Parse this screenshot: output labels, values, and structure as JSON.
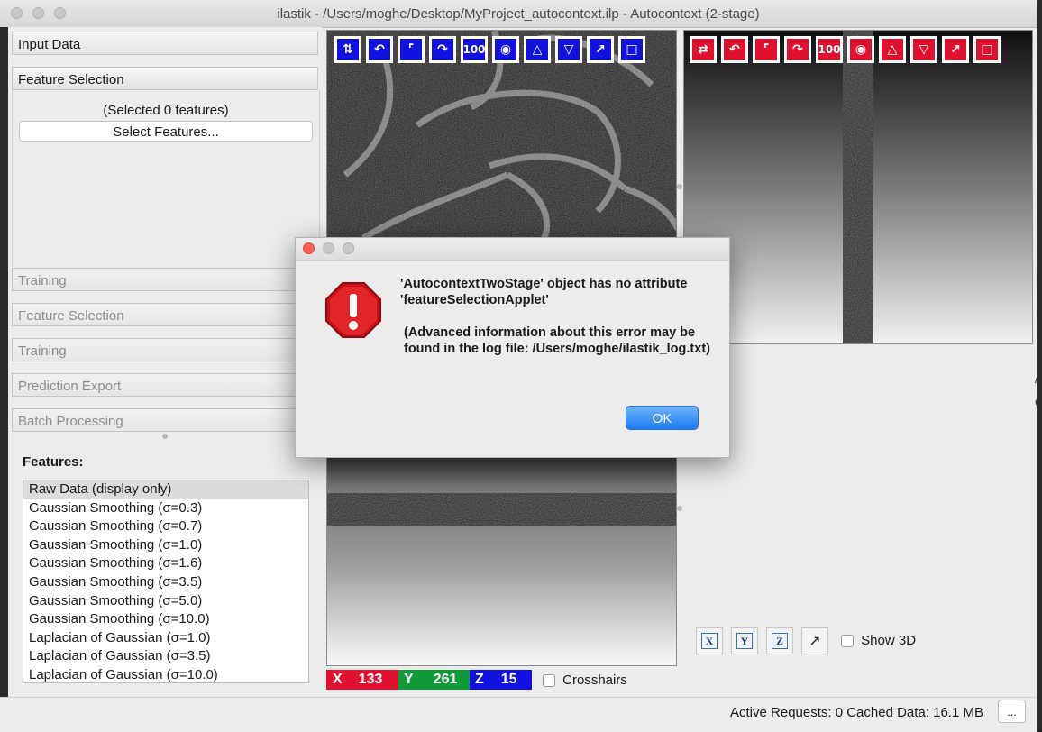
{
  "window": {
    "title": "ilastik - /Users/moghe/Desktop/MyProject_autocontext.ilp - Autocontext (2-stage)"
  },
  "applets": {
    "input_data": "Input Data",
    "feature_selection": "Feature Selection",
    "selected_count": "(Selected 0 features)",
    "select_features_button": "Select Features...",
    "training_1": "Training",
    "feature_selection_2": "Feature Selection",
    "training_2": "Training",
    "prediction_export": "Prediction Export",
    "batch_processing": "Batch Processing"
  },
  "features": {
    "label": "Features:",
    "items": [
      "Raw Data (display only)",
      "Gaussian Smoothing (σ=0.3)",
      "Gaussian Smoothing (σ=0.7)",
      "Gaussian Smoothing (σ=1.0)",
      "Gaussian Smoothing (σ=1.6)",
      "Gaussian Smoothing (σ=3.5)",
      "Gaussian Smoothing (σ=5.0)",
      "Gaussian Smoothing (σ=10.0)",
      "Laplacian of Gaussian (σ=1.0)",
      "Laplacian of Gaussian (σ=3.5)",
      "Laplacian of Gaussian (σ=10.0)"
    ],
    "selected_index": 0
  },
  "viewer": {
    "zoom_label": "100",
    "blue_color": "#1212e0",
    "red_color": "#e0102e",
    "green_color": "#0f9a3a",
    "coords": {
      "x_label": "X",
      "x_value": "133",
      "y_label": "Y",
      "y_value": "261",
      "z_label": "Z",
      "z_value": "15"
    },
    "crosshairs_label": "Crosshairs",
    "axis_buttons": [
      "X",
      "Y",
      "Z"
    ],
    "show3d_label": "Show 3D"
  },
  "status": {
    "text": "Active Requests: 0  Cached Data: 16.1 MB",
    "button": "..."
  },
  "dialog": {
    "message_line1": "'AutocontextTwoStage' object has no attribute 'featureSelectionApplet'",
    "message_line2": "(Advanced information about this error may be found in the log file: /Users/moghe/ilastik_log.txt)",
    "ok_label": "OK"
  }
}
